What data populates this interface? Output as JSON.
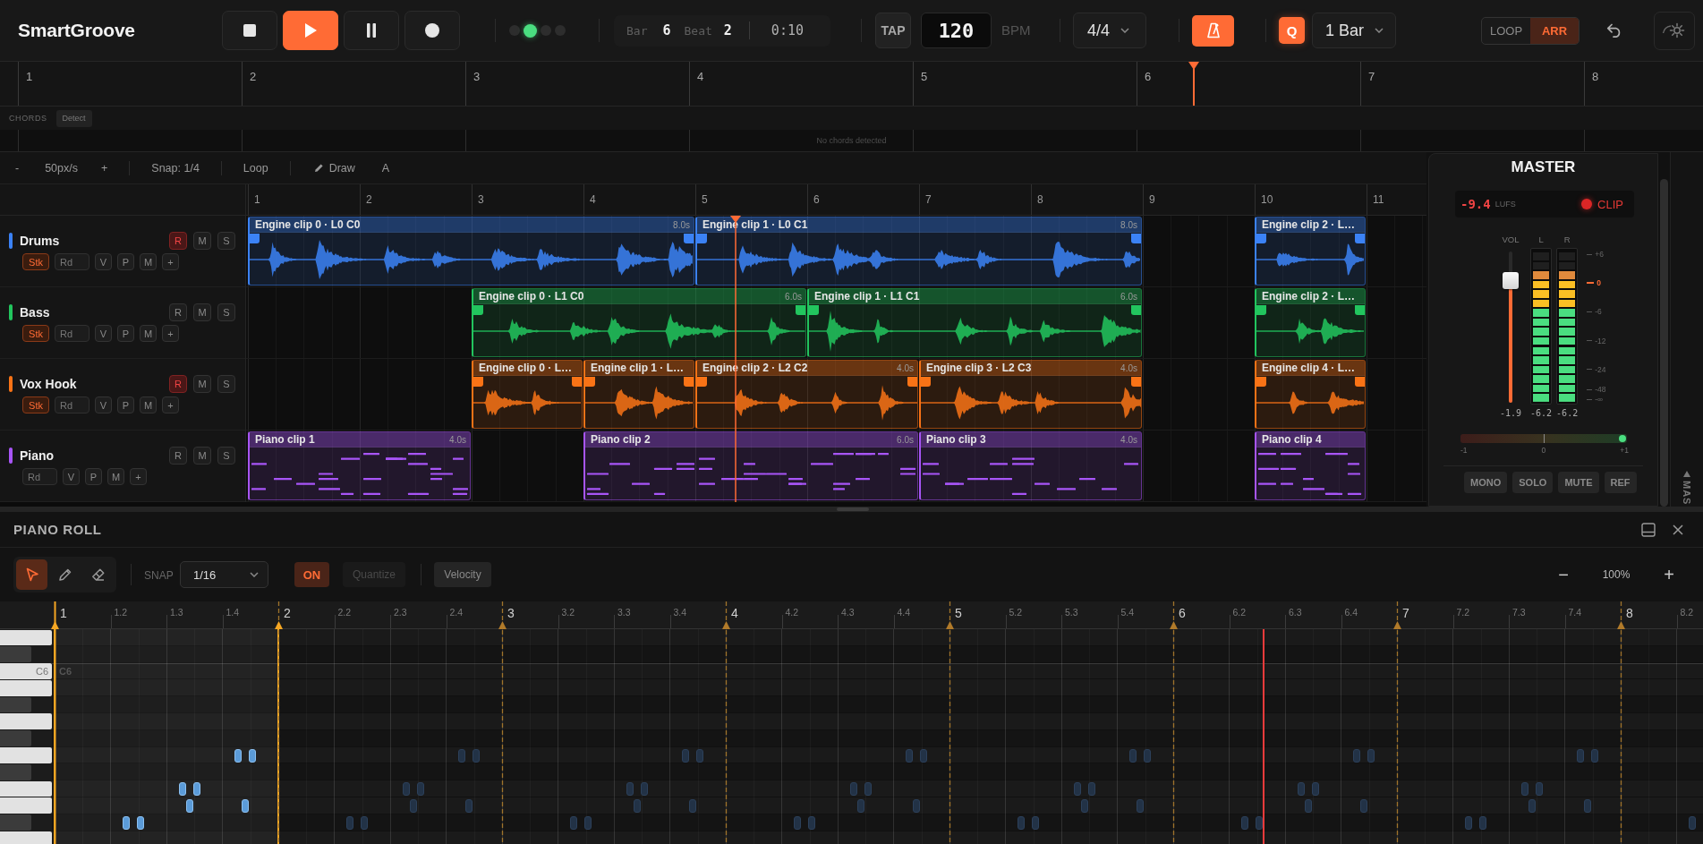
{
  "app": {
    "title": "SmartGroove"
  },
  "transport": {
    "buttons": [
      {
        "kind": "stop",
        "selected": false
      },
      {
        "kind": "play",
        "selected": true
      },
      {
        "kind": "pause",
        "selected": false
      },
      {
        "kind": "record",
        "selected": false
      }
    ],
    "status_dots": [
      {
        "on": false
      },
      {
        "on": true
      },
      {
        "on": false
      },
      {
        "on": false
      }
    ],
    "position": {
      "bar_label": "Bar",
      "bar": "6",
      "beat_label": "Beat",
      "beat": "2",
      "time": "0:10"
    }
  },
  "tempo": {
    "tap": "TAP",
    "bpm": "120",
    "unit": "BPM"
  },
  "time_signature": {
    "value": "4/4"
  },
  "metronome": {
    "on": true
  },
  "quantize": {
    "label": "Q",
    "on": true,
    "value": "1 Bar"
  },
  "view_modes": [
    {
      "label": "LOOP",
      "selected": false
    },
    {
      "label": "ARR",
      "selected": true
    }
  ],
  "timeline": {
    "bars": [
      "1",
      "2",
      "3",
      "4",
      "5",
      "6",
      "7",
      "8"
    ]
  },
  "chords": {
    "label": "CHORDS",
    "detect": "Detect",
    "message": "No chords detected"
  },
  "arrange_toolbar": {
    "zoom_out": "-",
    "zoom": "50px/s",
    "zoom_in": "+",
    "snap": "Snap: 1/4",
    "loop": "Loop",
    "draw": "Draw",
    "auto": "A"
  },
  "arrange": {
    "bars": [
      "1",
      "2",
      "3",
      "4",
      "5",
      "6",
      "7",
      "8",
      "9",
      "10",
      "11"
    ],
    "tracks": [
      {
        "name": "Drums",
        "color": "#3b82f6",
        "arm": {
          "label": "R",
          "on": true
        },
        "mute": "M",
        "solo": "S",
        "stack": {
          "label": "Stk",
          "on": true
        },
        "input": "Rd",
        "toggles": [
          "V",
          "P",
          "M"
        ],
        "add": "+",
        "clips": [
          {
            "kind": "audio",
            "title": "Engine clip 0 · L0 C0",
            "duration": "8.0s"
          },
          {
            "kind": "audio",
            "title": "Engine clip 1 · L0 C1",
            "duration": "8.0s"
          },
          {
            "kind": "audio",
            "title": "Engine clip 2 · L…"
          }
        ]
      },
      {
        "name": "Bass",
        "color": "#22c55e",
        "arm": {
          "label": "R",
          "on": false
        },
        "mute": "M",
        "solo": "S",
        "stack": {
          "label": "Stk",
          "on": true
        },
        "input": "Rd",
        "toggles": [
          "V",
          "P",
          "M"
        ],
        "add": "+",
        "clips": [
          {
            "kind": "audio",
            "title": "Engine clip 0 · L1 C0",
            "duration": "6.0s"
          },
          {
            "kind": "audio",
            "title": "Engine clip 1 · L1 C1",
            "duration": "6.0s"
          },
          {
            "kind": "audio",
            "title": "Engine clip 2 · L…"
          }
        ]
      },
      {
        "name": "Vox Hook",
        "color": "#f97316",
        "arm": {
          "label": "R",
          "on": true
        },
        "mute": "M",
        "solo": "S",
        "stack": {
          "label": "Stk",
          "on": true
        },
        "input": "Rd",
        "toggles": [
          "V",
          "P",
          "M"
        ],
        "add": "+",
        "clips": [
          {
            "kind": "audio",
            "title": "Engine clip 0 · L…"
          },
          {
            "kind": "audio",
            "title": "Engine clip 1 · L…"
          },
          {
            "kind": "audio",
            "title": "Engine clip 2 · L2 C2",
            "duration": "4.0s"
          },
          {
            "kind": "audio",
            "title": "Engine clip 3 · L2 C3",
            "duration": "4.0s"
          },
          {
            "kind": "audio",
            "title": "Engine clip 4 · L…"
          }
        ]
      },
      {
        "name": "Piano",
        "color": "#a855f7",
        "arm": {
          "label": "R",
          "on": false
        },
        "mute": "M",
        "solo": "S",
        "input": "Rd",
        "toggles": [
          "V",
          "P",
          "M"
        ],
        "add": "+",
        "clips": [
          {
            "kind": "midi",
            "title": "Piano clip 1",
            "duration": "4.0s"
          },
          {
            "kind": "midi",
            "title": "Piano clip 2",
            "duration": "6.0s"
          },
          {
            "kind": "midi",
            "title": "Piano clip 3",
            "duration": "4.0s"
          },
          {
            "kind": "midi",
            "title": "Piano clip 4"
          }
        ]
      }
    ]
  },
  "master": {
    "title": "MASTER",
    "lufs": {
      "value": "-9.4",
      "unit": "LUFS"
    },
    "clip_indicator": {
      "label": "CLIP",
      "on": true
    },
    "fader": {
      "label": "VOL",
      "level": 0.85,
      "reading": "-1.9"
    },
    "meters": [
      {
        "label": "L",
        "level": 0.875,
        "reading": "-6.2"
      },
      {
        "label": "R",
        "level": 0.875,
        "reading": "-6.2"
      }
    ],
    "scale": [
      {
        "label": "+6",
        "kind": "tick"
      },
      {
        "label": "0",
        "kind": "ref"
      },
      {
        "label": "-6",
        "kind": "tick"
      },
      {
        "label": "-12",
        "kind": "tick"
      },
      {
        "label": "-24",
        "kind": "tick"
      },
      {
        "label": "-48",
        "kind": "tick"
      },
      {
        "label": "-∞",
        "kind": "tick"
      }
    ],
    "correlation": {
      "level": 1,
      "labels": [
        "-1",
        "0",
        "+1"
      ]
    },
    "buttons": [
      "MONO",
      "SOLO",
      "MUTE",
      "REF"
    ]
  },
  "side_tab": {
    "label": "MAS"
  },
  "piano_roll": {
    "title": "PIANO ROLL",
    "tools": [
      {
        "kind": "select",
        "selected": true
      },
      {
        "kind": "pencil",
        "selected": false
      },
      {
        "kind": "eraser",
        "selected": false
      }
    ],
    "snap": {
      "label": "SNAP",
      "value": "1/16"
    },
    "snap_toggle": {
      "label": "ON",
      "on": true
    },
    "quantize": {
      "label": "Quantize",
      "disabled": true
    },
    "velocity": {
      "label": "Velocity"
    },
    "zoom": {
      "out": "−",
      "value": "100%",
      "in": "+"
    },
    "ruler": [
      {
        "label": "1",
        "selected": true,
        "beats": [
          "1.2",
          "1.3",
          "1.4"
        ]
      },
      {
        "label": "2",
        "selected": false,
        "beats": [
          "2.2",
          "2.3",
          "2.4"
        ]
      },
      {
        "label": "3",
        "selected": false,
        "beats": [
          "3.2",
          "3.3",
          "3.4"
        ]
      },
      {
        "label": "4",
        "selected": false,
        "beats": [
          "4.2",
          "4.3",
          "4.4"
        ]
      },
      {
        "label": "5",
        "selected": false,
        "beats": [
          "5.2",
          "5.3",
          "5.4"
        ]
      },
      {
        "label": "6",
        "selected": false,
        "beats": [
          "6.2",
          "6.3",
          "6.4"
        ]
      },
      {
        "label": "7",
        "selected": false,
        "beats": [
          "7.2",
          "7.3",
          "7.4"
        ]
      },
      {
        "label": "8",
        "selected": false,
        "beats": [
          "8.2"
        ]
      }
    ],
    "keys": [
      {
        "kind": "white"
      },
      {
        "kind": "black"
      },
      {
        "kind": "white",
        "label": "C6"
      },
      {
        "kind": "white"
      },
      {
        "kind": "black"
      },
      {
        "kind": "white"
      },
      {
        "kind": "black"
      },
      {
        "kind": "white"
      },
      {
        "kind": "black"
      },
      {
        "kind": "white"
      },
      {
        "kind": "white"
      },
      {
        "kind": "black"
      },
      {
        "kind": "white"
      }
    ],
    "row_label": "C6"
  }
}
